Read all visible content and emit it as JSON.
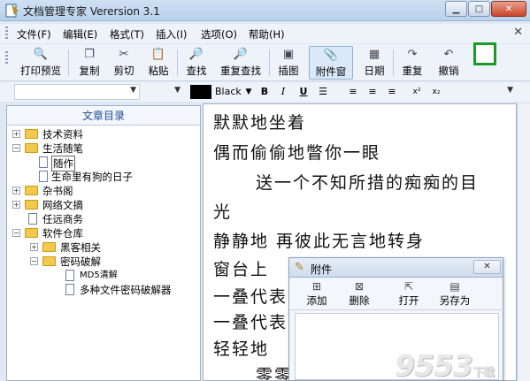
{
  "window": {
    "title": "文档管理专家 Verersion 3.1",
    "minimize_icon": "minimize-icon",
    "maximize_icon": "maximize-icon",
    "close_label": "✕"
  },
  "menu": [
    "文件(F)",
    "编辑(E)",
    "格式(T)",
    "插入(I)",
    "选项(O)",
    "帮助(H)"
  ],
  "menu_close": "✕",
  "toolbar": {
    "print_preview": "打印预览",
    "copy": "复制",
    "cut": "剪切",
    "paste": "粘贴",
    "find": "查找",
    "find_again": "重复查找",
    "insert_image": "插图",
    "attachments": "附件窗",
    "date": "日期",
    "redo": "重复",
    "undo": "撤销"
  },
  "format": {
    "color_name": "Black",
    "bold": "B",
    "italic": "I",
    "underline": "U",
    "superscript": "x²",
    "subscript": "x₂"
  },
  "tree": {
    "title": "文章目录",
    "nodes": [
      {
        "label": "技术资料"
      },
      {
        "label": "生活随笔"
      },
      {
        "label": "随作"
      },
      {
        "label": "生命里有狗的日子"
      },
      {
        "label": "杂书阁"
      },
      {
        "label": "网络文摘"
      },
      {
        "label": "任远商务"
      },
      {
        "label": "软件仓库"
      },
      {
        "label": "黑客相关"
      },
      {
        "label": "密码破解"
      },
      {
        "label": "MD5清解"
      },
      {
        "label": "多种文件密码破解器"
      }
    ]
  },
  "editor": {
    "lines": [
      "默默地坐着",
      "偶而偷偷地瞥你一眼",
      "送一个不知所措的痴痴的目",
      "光",
      "静静地   再彼此无言地转身",
      "窗台上",
      "一叠代表",
      "一叠代表",
      "轻轻地",
      "零零"
    ]
  },
  "dialog": {
    "title": "附件",
    "close_label": "✕",
    "add": "添加",
    "delete": "删除",
    "open": "打开",
    "save_as": "另存为"
  },
  "watermark": "9553",
  "watermark_suffix": "下载"
}
